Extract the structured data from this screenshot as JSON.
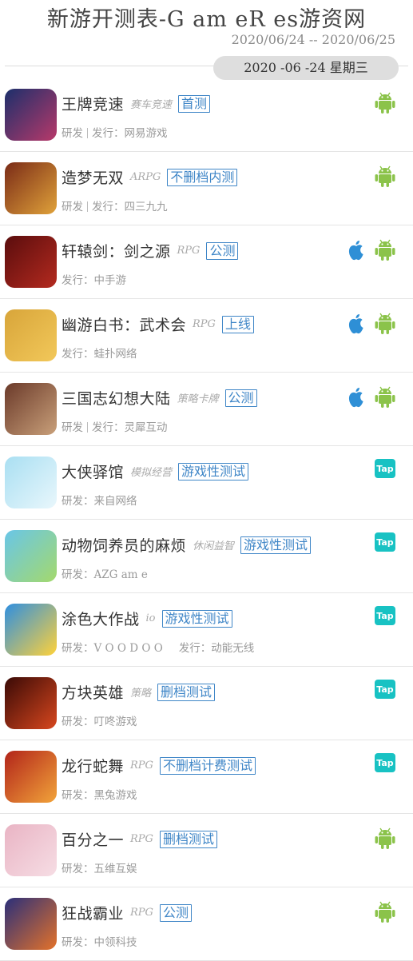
{
  "header": {
    "title": "新游开测表-G am eR es游资网",
    "date_range": "2020/06/24 -- 2020/06/25",
    "day_label": "2020 -06 -24 星期三"
  },
  "colors": {
    "android": "#8bc34a",
    "ios": "#2e8fd6",
    "taptap": "#18c2c3",
    "status": "#3f86c7"
  },
  "games": [
    {
      "name": "王牌竞速",
      "genre": "赛车竞速",
      "status": "首测",
      "meta": [
        "研发",
        "发行：网易游戏"
      ],
      "platforms": [
        "android"
      ],
      "icon": "racing-avatar",
      "icon_bg": [
        "#1c2f6b",
        "#b8396a"
      ]
    },
    {
      "name": "造梦无双",
      "genre": "ARPG",
      "status": "不删档内测",
      "meta": [
        "研发",
        "发行：四三九九"
      ],
      "platforms": [
        "android"
      ],
      "icon": "warrior-avatar",
      "icon_bg": [
        "#7a2b17",
        "#e0a23a"
      ]
    },
    {
      "name": "轩辕剑：剑之源",
      "genre": "RPG",
      "status": "公测",
      "meta": [
        "发行：中手游"
      ],
      "platforms": [
        "ios",
        "android"
      ],
      "icon": "calligraphy-logo",
      "icon_bg": [
        "#5a0d0d",
        "#b42a1f"
      ]
    },
    {
      "name": "幽游白书：武术会",
      "genre": "RPG",
      "status": "上线",
      "meta": [
        "发行：蛙扑网络"
      ],
      "platforms": [
        "ios",
        "android"
      ],
      "icon": "anime-boy-avatar",
      "icon_bg": [
        "#d8a53a",
        "#f2c85a"
      ]
    },
    {
      "name": "三国志幻想大陆",
      "genre": "策略卡牌",
      "status": "公测",
      "meta": [
        "研发",
        "发行：灵犀互动"
      ],
      "platforms": [
        "ios",
        "android"
      ],
      "icon": "general-avatar",
      "icon_bg": [
        "#6b3a2a",
        "#c9a07a"
      ]
    },
    {
      "name": "大侠驿馆",
      "genre": "模拟经营",
      "status": "游戏性测试",
      "meta": [
        "研发：来自网络"
      ],
      "platforms": [
        "taptap"
      ],
      "taptap_label": "Tap",
      "icon": "panda-avatar",
      "icon_bg": [
        "#a9dff2",
        "#e9f7fc"
      ]
    },
    {
      "name": "动物饲养员的麻烦",
      "genre": "休闲益智",
      "status": "游戏性测试",
      "meta": [
        "研发：AZG am e"
      ],
      "platforms": [
        "taptap"
      ],
      "taptap_label": "Tap",
      "icon": "zookeeper-avatar",
      "icon_bg": [
        "#69c6e8",
        "#a4d96c"
      ]
    },
    {
      "name": "涂色大作战",
      "genre": "io",
      "status": "游戏性测试",
      "meta": [
        "研发：V O O D O O",
        "发行：动能无线"
      ],
      "platforms": [
        "taptap"
      ],
      "taptap_label": "Tap",
      "icon": "number-3-block",
      "icon_bg": [
        "#2f8fe0",
        "#ffd23a"
      ]
    },
    {
      "name": "方块英雄",
      "genre": "策略",
      "status": "删档测试",
      "meta": [
        "研发：叮咚游戏"
      ],
      "platforms": [
        "taptap"
      ],
      "taptap_label": "Tap",
      "icon": "sword-icon-art",
      "icon_bg": [
        "#3a0a06",
        "#d8471e"
      ]
    },
    {
      "name": "龙行蛇舞",
      "genre": "RPG",
      "status": "不删档计费测试",
      "meta": [
        "研发：黑兔游戏"
      ],
      "platforms": [
        "taptap"
      ],
      "taptap_label": "Tap",
      "icon": "dragon-warrior-avatar",
      "icon_bg": [
        "#b2241a",
        "#f2a43a"
      ]
    },
    {
      "name": "百分之一",
      "genre": "RPG",
      "status": "删档测试",
      "meta": [
        "研发：五维互娱"
      ],
      "platforms": [
        "android"
      ],
      "icon": "pink-hair-girl-avatar",
      "icon_bg": [
        "#e9b4c4",
        "#f6dde4"
      ]
    },
    {
      "name": "狂战霸业",
      "genre": "RPG",
      "status": "公测",
      "meta": [
        "研发：中领科技"
      ],
      "platforms": [
        "android"
      ],
      "icon": "fire-warrior-avatar",
      "icon_bg": [
        "#2a2f7a",
        "#e4722a"
      ]
    }
  ]
}
